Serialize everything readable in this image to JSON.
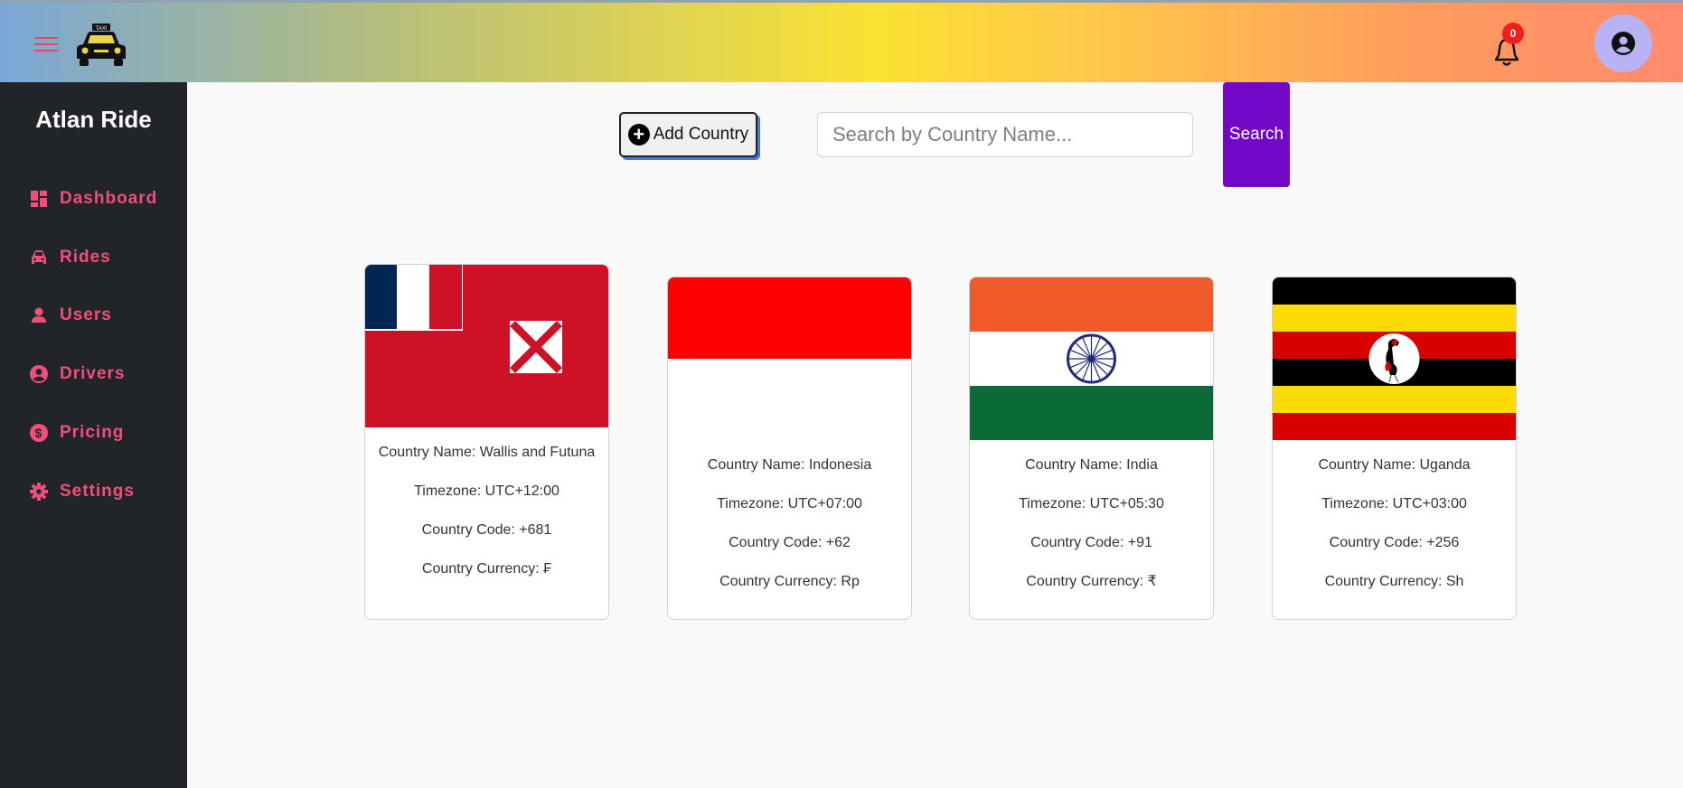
{
  "header": {
    "menu_icon": "hamburger-icon",
    "logo_icon": "taxi-icon",
    "logo_text": "TAXI",
    "notification_count": "0",
    "bell_icon": "bell-icon",
    "profile_icon": "user-circle-icon"
  },
  "sidebar": {
    "brand": "Atlan Ride",
    "items": [
      {
        "label": "Dashboard",
        "icon": "dashboard-icon"
      },
      {
        "label": "Rides",
        "icon": "car-icon"
      },
      {
        "label": "Users",
        "icon": "user-icon"
      },
      {
        "label": "Drivers",
        "icon": "user-circle-icon"
      },
      {
        "label": "Pricing",
        "icon": "dollar-icon"
      },
      {
        "label": "Settings",
        "icon": "gear-icon"
      }
    ]
  },
  "toolbar": {
    "add_label": "Add Country",
    "search_placeholder": "Search by Country Name...",
    "search_label": "Search"
  },
  "cards": [
    {
      "name": "Country Name: Wallis and Futuna",
      "timezone": "Timezone: UTC+12:00",
      "code": "Country Code: +681",
      "currency": "Country Currency: ₣"
    },
    {
      "name": "Country Name: Indonesia",
      "timezone": "Timezone: UTC+07:00",
      "code": "Country Code: +62",
      "currency": "Country Currency: Rp"
    },
    {
      "name": "Country Name: India",
      "timezone": "Timezone: UTC+05:30",
      "code": "Country Code: +91",
      "currency": "Country Currency: ₹"
    },
    {
      "name": "Country Name: Uganda",
      "timezone": "Timezone: UTC+03:00",
      "code": "Country Code: +256",
      "currency": "Country Currency: Sh"
    }
  ],
  "colors": {
    "accent": "#f14e7c",
    "sidebar": "#212529",
    "search_button": "#7207c7",
    "badge": "#f01e1e"
  }
}
